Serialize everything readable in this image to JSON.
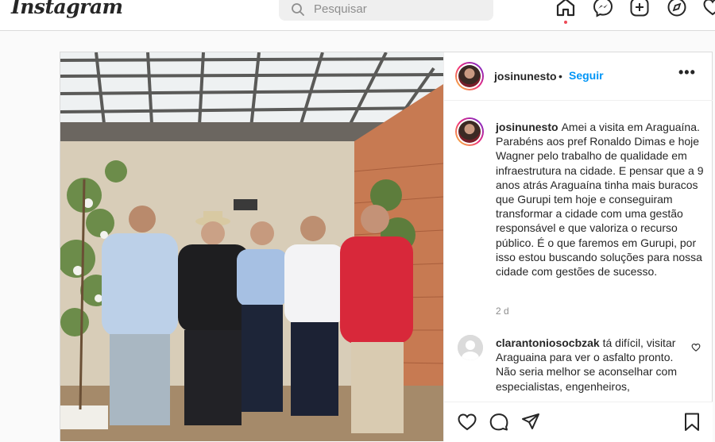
{
  "app": {
    "logo": "Instagram"
  },
  "search": {
    "placeholder": "Pesquisar"
  },
  "nav": {
    "icons": [
      "home-icon",
      "messenger-icon",
      "new-post-icon",
      "explore-icon",
      "activity-heart-icon"
    ]
  },
  "post": {
    "author": "josinunesto",
    "separator": "•",
    "follow_label": "Seguir",
    "more_label": "•••",
    "caption_author": "josinunesto",
    "caption_text": "Amei a visita em Araguaína. Parabéns aos pref Ronaldo Dimas e hoje Wagner pelo trabalho de qualidade em infraestrutura na cidade. E pensar que a 9 anos atrás Araguaína tinha mais buracos que Gurupi tem hoje e conseguiram transformar a cidade com uma gestão responsável e que valoriza o recurso público. É o que faremos em Gurupi, por isso estou buscando soluções para nossa cidade com gestões de sucesso.",
    "time": "2 d",
    "comment": {
      "author": "clarantoniosocbzak",
      "text": "tá difícil, visitar Araguaina para ver o asfalto pronto. Não seria melhor se aconselhar com especialistas, engenheiros, geotecnicos, fiscais e não a um"
    }
  },
  "colors": {
    "accent": "#0095f6",
    "border": "#dbdbdb",
    "shirt_red": "#d8283a"
  }
}
